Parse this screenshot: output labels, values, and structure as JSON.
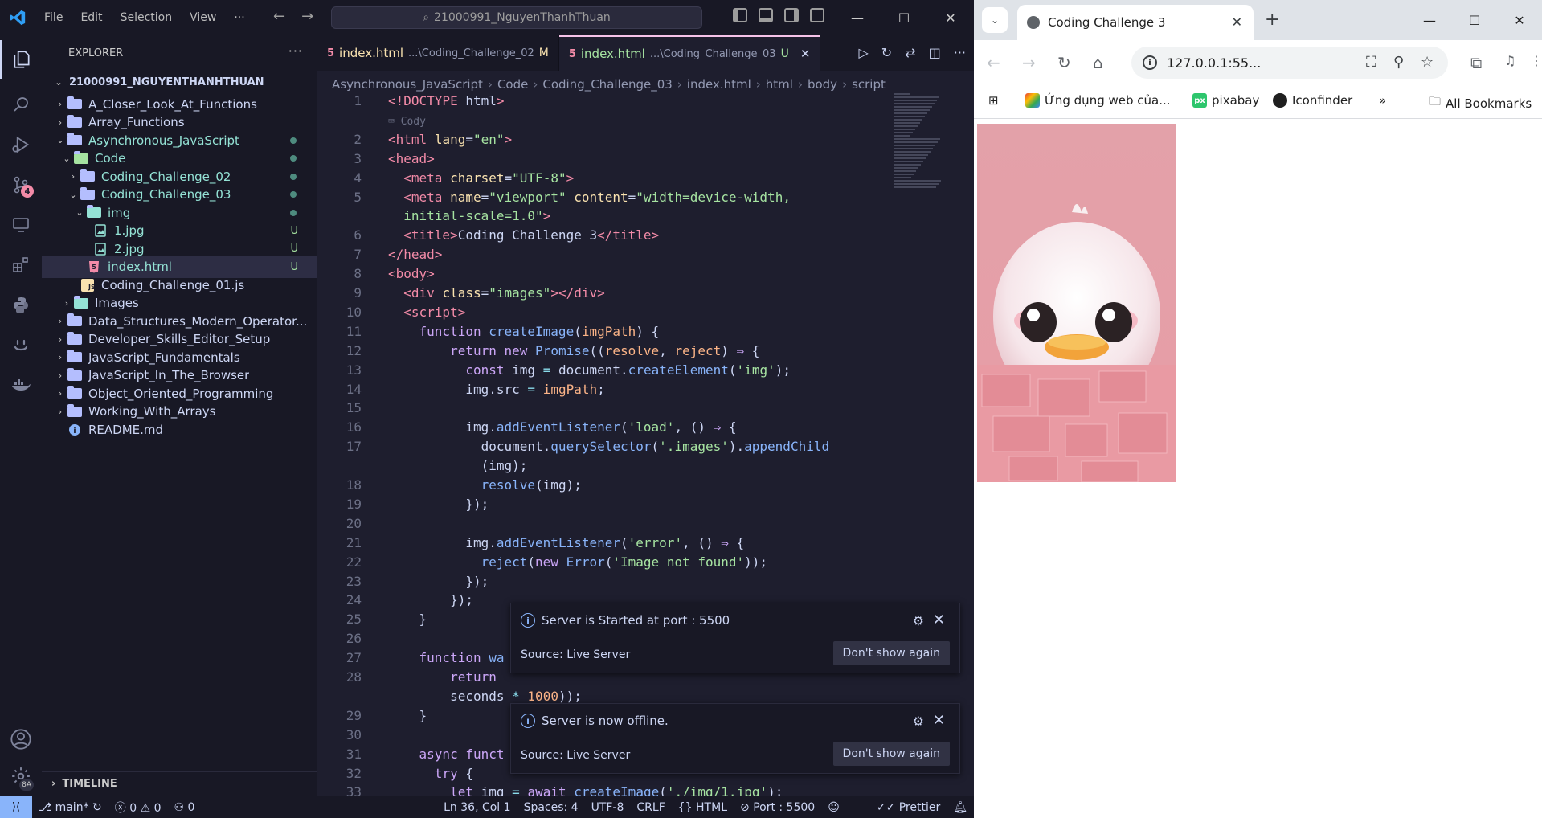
{
  "vscode": {
    "menu": [
      "File",
      "Edit",
      "Selection",
      "View",
      "···"
    ],
    "search": "21000991_NguyenThanhThuan",
    "explorer_title": "EXPLORER",
    "explorer_more": "···",
    "root": "21000991_NGUYENTHANHTHUAN",
    "tree": [
      {
        "label": "A_Closer_Look_At_Functions",
        "chev": "›",
        "type": "folder"
      },
      {
        "label": "Array_Functions",
        "chev": "›",
        "type": "folder"
      },
      {
        "label": "Asynchronous_JavaScript",
        "chev": "⌄",
        "type": "folder-open",
        "status": "dot"
      },
      {
        "label": "Code",
        "chev": "⌄",
        "type": "folder-code",
        "status": "dot"
      },
      {
        "label": "Coding_Challenge_02",
        "chev": "›",
        "type": "folder",
        "status": "dot"
      },
      {
        "label": "Coding_Challenge_03",
        "chev": "⌄",
        "type": "folder-open",
        "status": "dot"
      },
      {
        "label": "img",
        "chev": "⌄",
        "type": "folder-img",
        "status": "dot"
      },
      {
        "label": "1.jpg",
        "type": "image",
        "status": "U"
      },
      {
        "label": "2.jpg",
        "type": "image",
        "status": "U"
      },
      {
        "label": "index.html",
        "type": "html",
        "status": "U"
      },
      {
        "label": "Coding_Challenge_01.js",
        "type": "js"
      },
      {
        "label": "Images",
        "chev": "›",
        "type": "folder-img"
      },
      {
        "label": "Data_Structures_Modern_Operator...",
        "chev": "›",
        "type": "folder"
      },
      {
        "label": "Developer_Skills_Editor_Setup",
        "chev": "›",
        "type": "folder"
      },
      {
        "label": "JavaScript_Fundamentals",
        "chev": "›",
        "type": "folder"
      },
      {
        "label": "JavaScript_In_The_Browser",
        "chev": "›",
        "type": "folder"
      },
      {
        "label": "Object_Oriented_Programming",
        "chev": "›",
        "type": "folder"
      },
      {
        "label": "Working_With_Arrays",
        "chev": "›",
        "type": "folder"
      },
      {
        "label": "README.md",
        "type": "info"
      }
    ],
    "timeline": "TIMELINE",
    "tabs": [
      {
        "name": "index.html",
        "path": "...\\Coding_Challenge_02",
        "flag": "M"
      },
      {
        "name": "index.html",
        "path": "...\\Coding_Challenge_03",
        "flag": "U",
        "close": "✕"
      }
    ],
    "breadcrumb": [
      "Asynchronous_JavaScript",
      "Code",
      "Coding_Challenge_03",
      "index.html",
      "html",
      "body",
      "script"
    ],
    "code_hint": "Cody",
    "toasts": [
      {
        "message": "Server is Started at port : 5500",
        "source": "Source: Live Server",
        "button": "Don't show again"
      },
      {
        "message": "Server is now offline.",
        "source": "Source: Live Server",
        "button": "Don't show again"
      }
    ],
    "activity_badge": "4",
    "settings_badge": "8A",
    "status": {
      "branch": "main*",
      "errors": "0",
      "warnings": "0",
      "ports": "0",
      "position": "Ln 36, Col 1",
      "spaces": "Spaces: 4",
      "encoding": "UTF-8",
      "eol": "CRLF",
      "language": "HTML",
      "port": "Port : 5500",
      "prettier": "Prettier"
    }
  },
  "chrome": {
    "tab_title": "Coding Challenge 3",
    "url": "127.0.0.1:55...",
    "bookmarks": [
      "Ứng dụng web của...",
      "pixabay",
      "Iconfinder",
      "All Bookmarks"
    ],
    "colors": {
      "accent": "#f5c2e7",
      "duck_bg": "#e8a5ad"
    }
  }
}
